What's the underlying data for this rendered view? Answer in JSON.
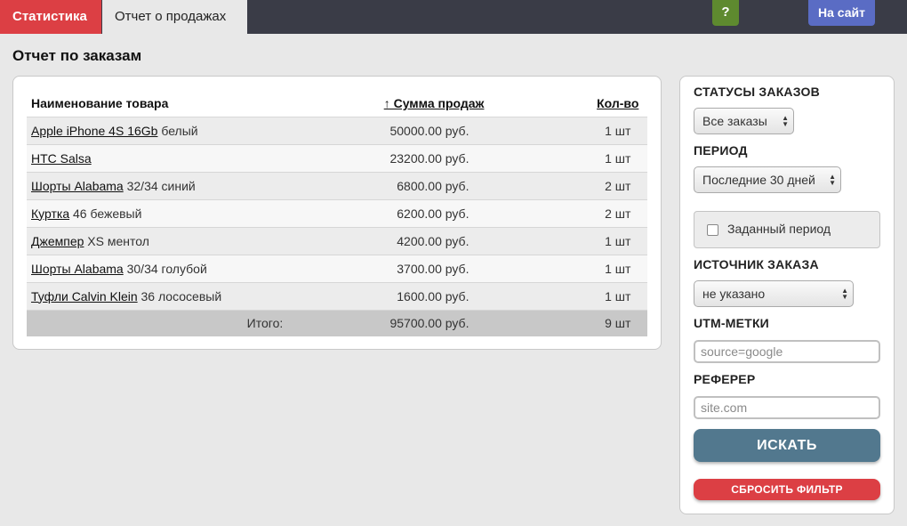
{
  "tabs": {
    "stats": "Статистика",
    "report": "Отчет о продажах"
  },
  "header": {
    "help": "?",
    "site": "На сайт"
  },
  "page_title": "Отчет по заказам",
  "table": {
    "headers": {
      "name": "Наименование товара",
      "sum": "↑ Сумма продаж",
      "qty": "Кол-во"
    },
    "rows": [
      {
        "link": "Apple iPhone 4S 16Gb",
        "variant": " белый",
        "sum": "50000.00 руб.",
        "qty": "1 шт"
      },
      {
        "link": "HTC Salsa",
        "variant": "",
        "sum": "23200.00 руб.",
        "qty": "1 шт"
      },
      {
        "link": "Шорты Alabama",
        "variant": " 32/34 синий",
        "sum": "6800.00 руб.",
        "qty": "2 шт"
      },
      {
        "link": "Куртка",
        "variant": " 46 бежевый",
        "sum": "6200.00 руб.",
        "qty": "2 шт"
      },
      {
        "link": "Джемпер",
        "variant": " XS ментол",
        "sum": "4200.00 руб.",
        "qty": "1 шт"
      },
      {
        "link": "Шорты Alabama",
        "variant": " 30/34 голубой",
        "sum": "3700.00 руб.",
        "qty": "1 шт"
      },
      {
        "link": "Туфли Calvin Klein",
        "variant": " 36 лососевый",
        "sum": "1600.00 руб.",
        "qty": "1 шт"
      }
    ],
    "total": {
      "label": "Итого:",
      "sum": "95700.00 руб.",
      "qty": "9 шт"
    }
  },
  "filters": {
    "status": {
      "label": "СТАТУСЫ ЗАКАЗОВ",
      "value": "Все заказы"
    },
    "period": {
      "label": "ПЕРИОД",
      "value": "Последние 30 дней"
    },
    "custom_period": {
      "label": "Заданный период",
      "checked": false
    },
    "source": {
      "label": "ИСТОЧНИК ЗАКАЗА",
      "value": "не указано"
    },
    "utm": {
      "label": "UTM-МЕТКИ",
      "placeholder": "source=google"
    },
    "referer": {
      "label": "РЕФЕРЕР",
      "placeholder": "site.com"
    },
    "search_button": "ИСКАТЬ",
    "reset_button": "СБРОСИТЬ ФИЛЬТР"
  },
  "colors": {
    "topbar": "#3a3c47",
    "accent_red": "#dc3f44",
    "help_green": "#5e8a2f",
    "site_blue": "#5a6cc4",
    "search_blue": "#52788e"
  }
}
